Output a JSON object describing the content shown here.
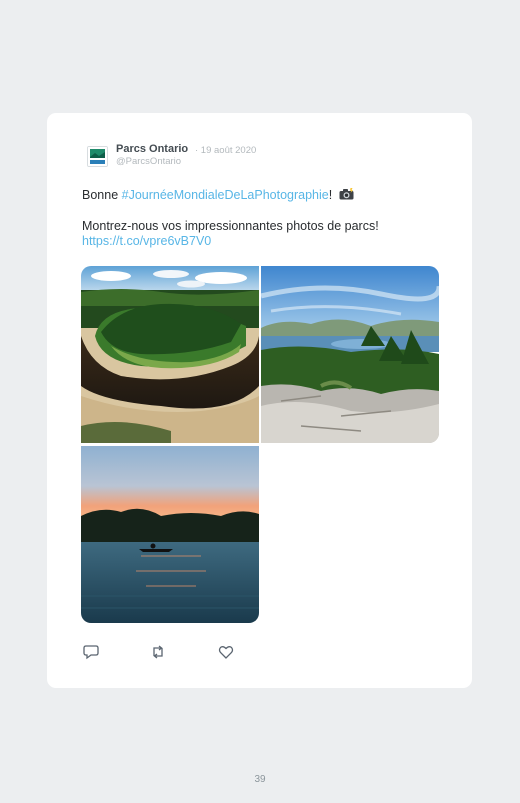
{
  "tweet": {
    "author_name": "Parcs Ontario",
    "date": "· 19 août 2020",
    "handle": "@ParcsOntario",
    "text_prefix": "Bonne ",
    "hashtag": "#JournéeMondialeDeLaPhotographie",
    "text_suffix": "!",
    "emoji_icon": "camera-with-flash-icon",
    "text_line2": "Montrez-nous vos impressionnantes photos de parcs!",
    "link": "https://t.co/vpre6vB7V0",
    "photos": [
      "river-bend-forest-photo",
      "lake-rocky-shore-photo",
      "sunset-lake-kayak-photo"
    ],
    "actions": [
      "reply-icon",
      "retweet-icon",
      "like-icon"
    ]
  },
  "page_number": "39",
  "colors": {
    "background": "#eceef0",
    "card": "#ffffff",
    "link": "#58b6e6",
    "text": "#2a2d30",
    "muted": "#b3b9bd"
  }
}
